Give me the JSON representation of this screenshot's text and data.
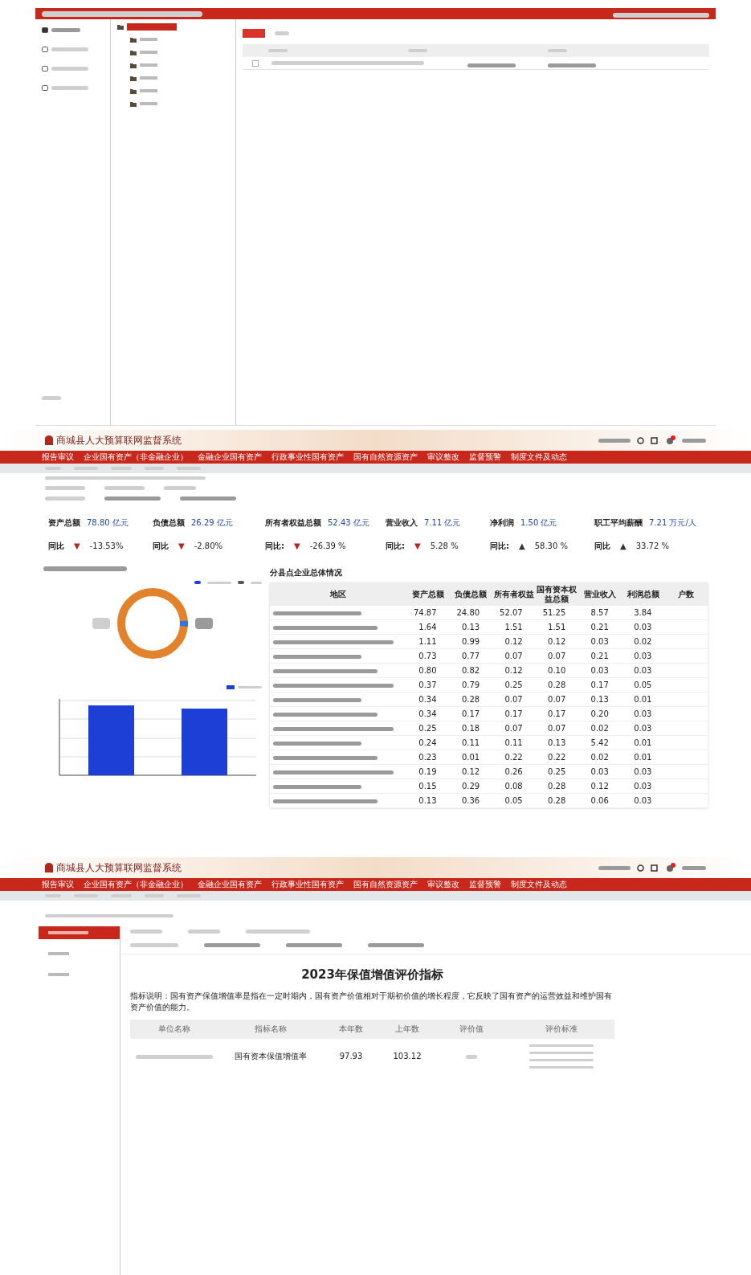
{
  "file_manager": {
    "sidebar_items": [
      {
        "selected": true
      },
      {
        "selected": false
      },
      {
        "selected": false
      },
      {
        "selected": false
      }
    ],
    "tree_items": [
      {
        "selected": true
      },
      {
        "selected": false
      },
      {
        "selected": false
      },
      {
        "selected": false
      },
      {
        "selected": false
      },
      {
        "selected": false
      },
      {
        "selected": false
      }
    ]
  },
  "dashboard": {
    "app_title": "商城县人大预算联网监督系统",
    "nav": [
      "报告审议",
      "企业国有资产（非金融企业）",
      "金融企业国有资产",
      "行政事业性国有资产",
      "国有自然资源资产",
      "审议整改",
      "监督预警",
      "制度文件及动态"
    ],
    "kpis": [
      {
        "label": "资产总额",
        "value": "78.80",
        "unit": "亿元",
        "change_label": "同比",
        "arrow": "▼",
        "color": "#b3281d",
        "change": "-13.53%"
      },
      {
        "label": "负债总额",
        "value": "26.29",
        "unit": "亿元",
        "change_label": "同比",
        "arrow": "▼",
        "color": "#b3281d",
        "change": "-2.80%"
      },
      {
        "label": "所有者权益总额",
        "value": "52.43",
        "unit": "亿元",
        "change_label": "同比:",
        "arrow": "▼",
        "color": "#b3281d",
        "change": "-26.39 %"
      },
      {
        "label": "营业收入",
        "value": "7.11",
        "unit": "亿元",
        "change_label": "同比:",
        "arrow": "▼",
        "color": "#b3281d",
        "change": "5.28 %"
      },
      {
        "label": "净利润",
        "value": "1.50",
        "unit": "亿元",
        "change_label": "同比:",
        "arrow": "▲",
        "color": "#333333",
        "change": "58.30 %"
      },
      {
        "label": "职工平均薪酬",
        "value": "7.21",
        "unit": "万元/人",
        "change_label": "同比",
        "arrow": "▲",
        "color": "#333333",
        "change": "33.72 %"
      }
    ],
    "table": {
      "title": "分县点企业总体情况",
      "columns": [
        "地区",
        "资产总额",
        "负债总额",
        "所有者权益",
        "国有资本权益总额",
        "营业收入",
        "利润总额",
        "户数"
      ],
      "rows": [
        [
          "",
          "74.87",
          "24.80",
          "52.07",
          "51.25",
          "8.57",
          "3.84"
        ],
        [
          "",
          "1.64",
          "0.13",
          "1.51",
          "1.51",
          "0.21",
          "0.03"
        ],
        [
          "",
          "1.11",
          "0.99",
          "0.12",
          "0.12",
          "0.03",
          "0.02"
        ],
        [
          "",
          "0.73",
          "0.77",
          "0.07",
          "0.07",
          "0.21",
          "0.03"
        ],
        [
          "",
          "0.80",
          "0.82",
          "0.12",
          "0.10",
          "0.03",
          "0.03"
        ],
        [
          "",
          "0.37",
          "0.79",
          "0.25",
          "0.28",
          "0.17",
          "0.05"
        ],
        [
          "",
          "0.34",
          "0.28",
          "0.07",
          "0.07",
          "0.13",
          "0.01"
        ],
        [
          "",
          "0.34",
          "0.17",
          "0.17",
          "0.17",
          "0.20",
          "0.03"
        ],
        [
          "",
          "0.25",
          "0.18",
          "0.07",
          "0.07",
          "0.02",
          "0.03"
        ],
        [
          "",
          "0.24",
          "0.11",
          "0.11",
          "0.13",
          "5.42",
          "0.01"
        ],
        [
          "",
          "0.23",
          "0.01",
          "0.22",
          "0.22",
          "0.02",
          "0.01"
        ],
        [
          "",
          "0.19",
          "0.12",
          "0.26",
          "0.25",
          "0.03",
          "0.03"
        ],
        [
          "",
          "0.15",
          "0.29",
          "0.08",
          "0.28",
          "0.12",
          "0.03"
        ],
        [
          "",
          "0.13",
          "0.36",
          "0.05",
          "0.28",
          "0.06",
          "0.03"
        ]
      ]
    }
  },
  "evaluation": {
    "app_title": "商城县人大预算联网监督系统",
    "nav": [
      "报告审议",
      "企业国有资产（非金融企业）",
      "金融企业国有资产",
      "行政事业性国有资产",
      "国有自然资源资产",
      "审议整改",
      "监督预警",
      "制度文件及动态"
    ],
    "side_menu": [
      {
        "selected": true
      },
      {
        "selected": false
      },
      {
        "selected": false
      }
    ],
    "title": "2023年保值增值评价指标",
    "description": "指标说明：国有资产保值增值率是指在一定时期内，国有资产价值相对于期初价值的增长程度，它反映了国有资产的运营效益和维护国有资产价值的能力。",
    "columns": [
      "单位名称",
      "指标名称",
      "本年数",
      "上年数",
      "评价值",
      "评价标准"
    ],
    "rows": [
      {
        "indicator": "国有资本保值增值率",
        "current": "97.93",
        "previous": "103.12"
      }
    ]
  }
}
